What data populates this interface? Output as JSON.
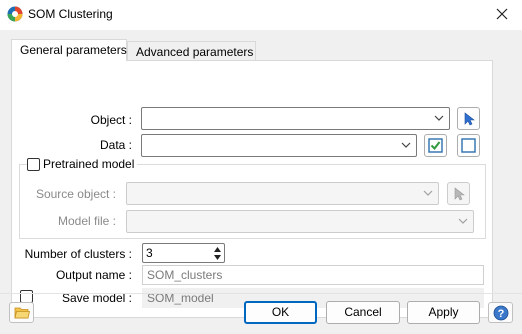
{
  "window": {
    "title": "SOM Clustering",
    "app_icon": "statistica-icon",
    "close_icon": "close-icon"
  },
  "tabs": [
    {
      "label": "General parameters",
      "selected": true
    },
    {
      "label": "Advanced parameters",
      "selected": false
    }
  ],
  "general": {
    "object_label": "Object :",
    "object_value": "",
    "data_label": "Data :",
    "data_value": "",
    "pretrained": {
      "label": "Pretrained model",
      "checked": false,
      "source_object_label": "Source object :",
      "source_object_value": "",
      "model_file_label": "Model file :",
      "model_file_value": ""
    },
    "clusters_label": "Number of clusters :",
    "clusters_value": "3",
    "output_name_label": "Output name :",
    "output_name_value": "SOM_clusters",
    "save_model_label": "Save model :",
    "save_model_checked": false,
    "save_model_value": "SOM_model"
  },
  "buttons": {
    "ok": "OK",
    "cancel": "Cancel",
    "apply": "Apply"
  },
  "icons": {
    "pick_object": "cursor-pick-icon",
    "select_all": "checkbox-select-icon",
    "deselect_all": "empty-box-icon",
    "open_folder": "folder-icon",
    "help": "help-icon"
  },
  "colors": {
    "accent": "#0067c0",
    "panel_bg": "#ffffff",
    "client_bg": "#f0f0f0"
  }
}
